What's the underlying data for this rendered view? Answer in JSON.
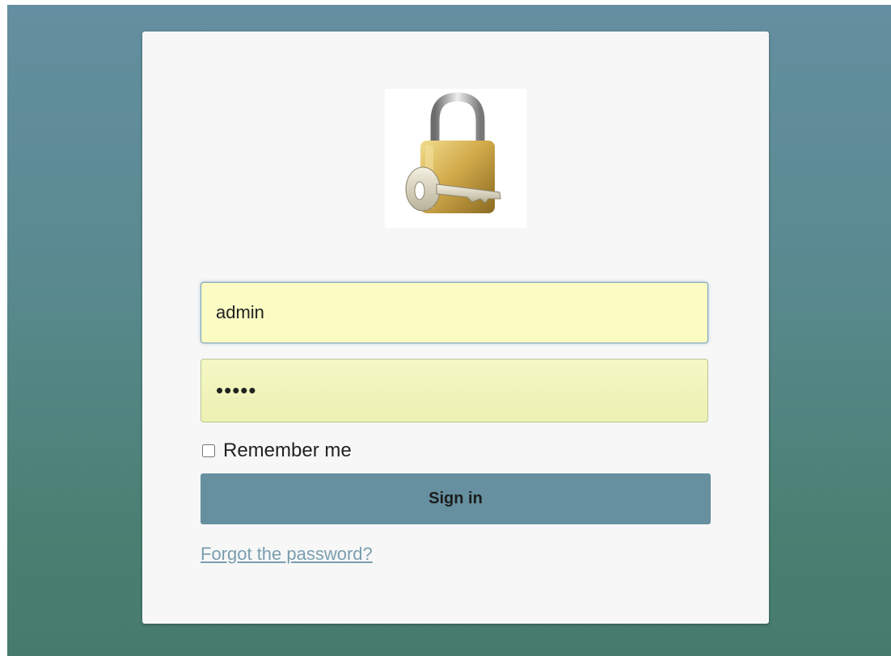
{
  "login": {
    "username_value": "admin",
    "password_value": "•••••",
    "remember_label": "Remember me",
    "remember_checked": false,
    "signin_label": "Sign in",
    "forgot_link": "Forgot the password?"
  },
  "colors": {
    "background_top": "#648fa0",
    "background_bottom": "#467b6c",
    "card": "#f7f7f7",
    "input_fill": "#fafcc3",
    "button": "#6690a0",
    "link": "#7a9eaf"
  },
  "icons": {
    "logo": "padlock-key-icon"
  }
}
